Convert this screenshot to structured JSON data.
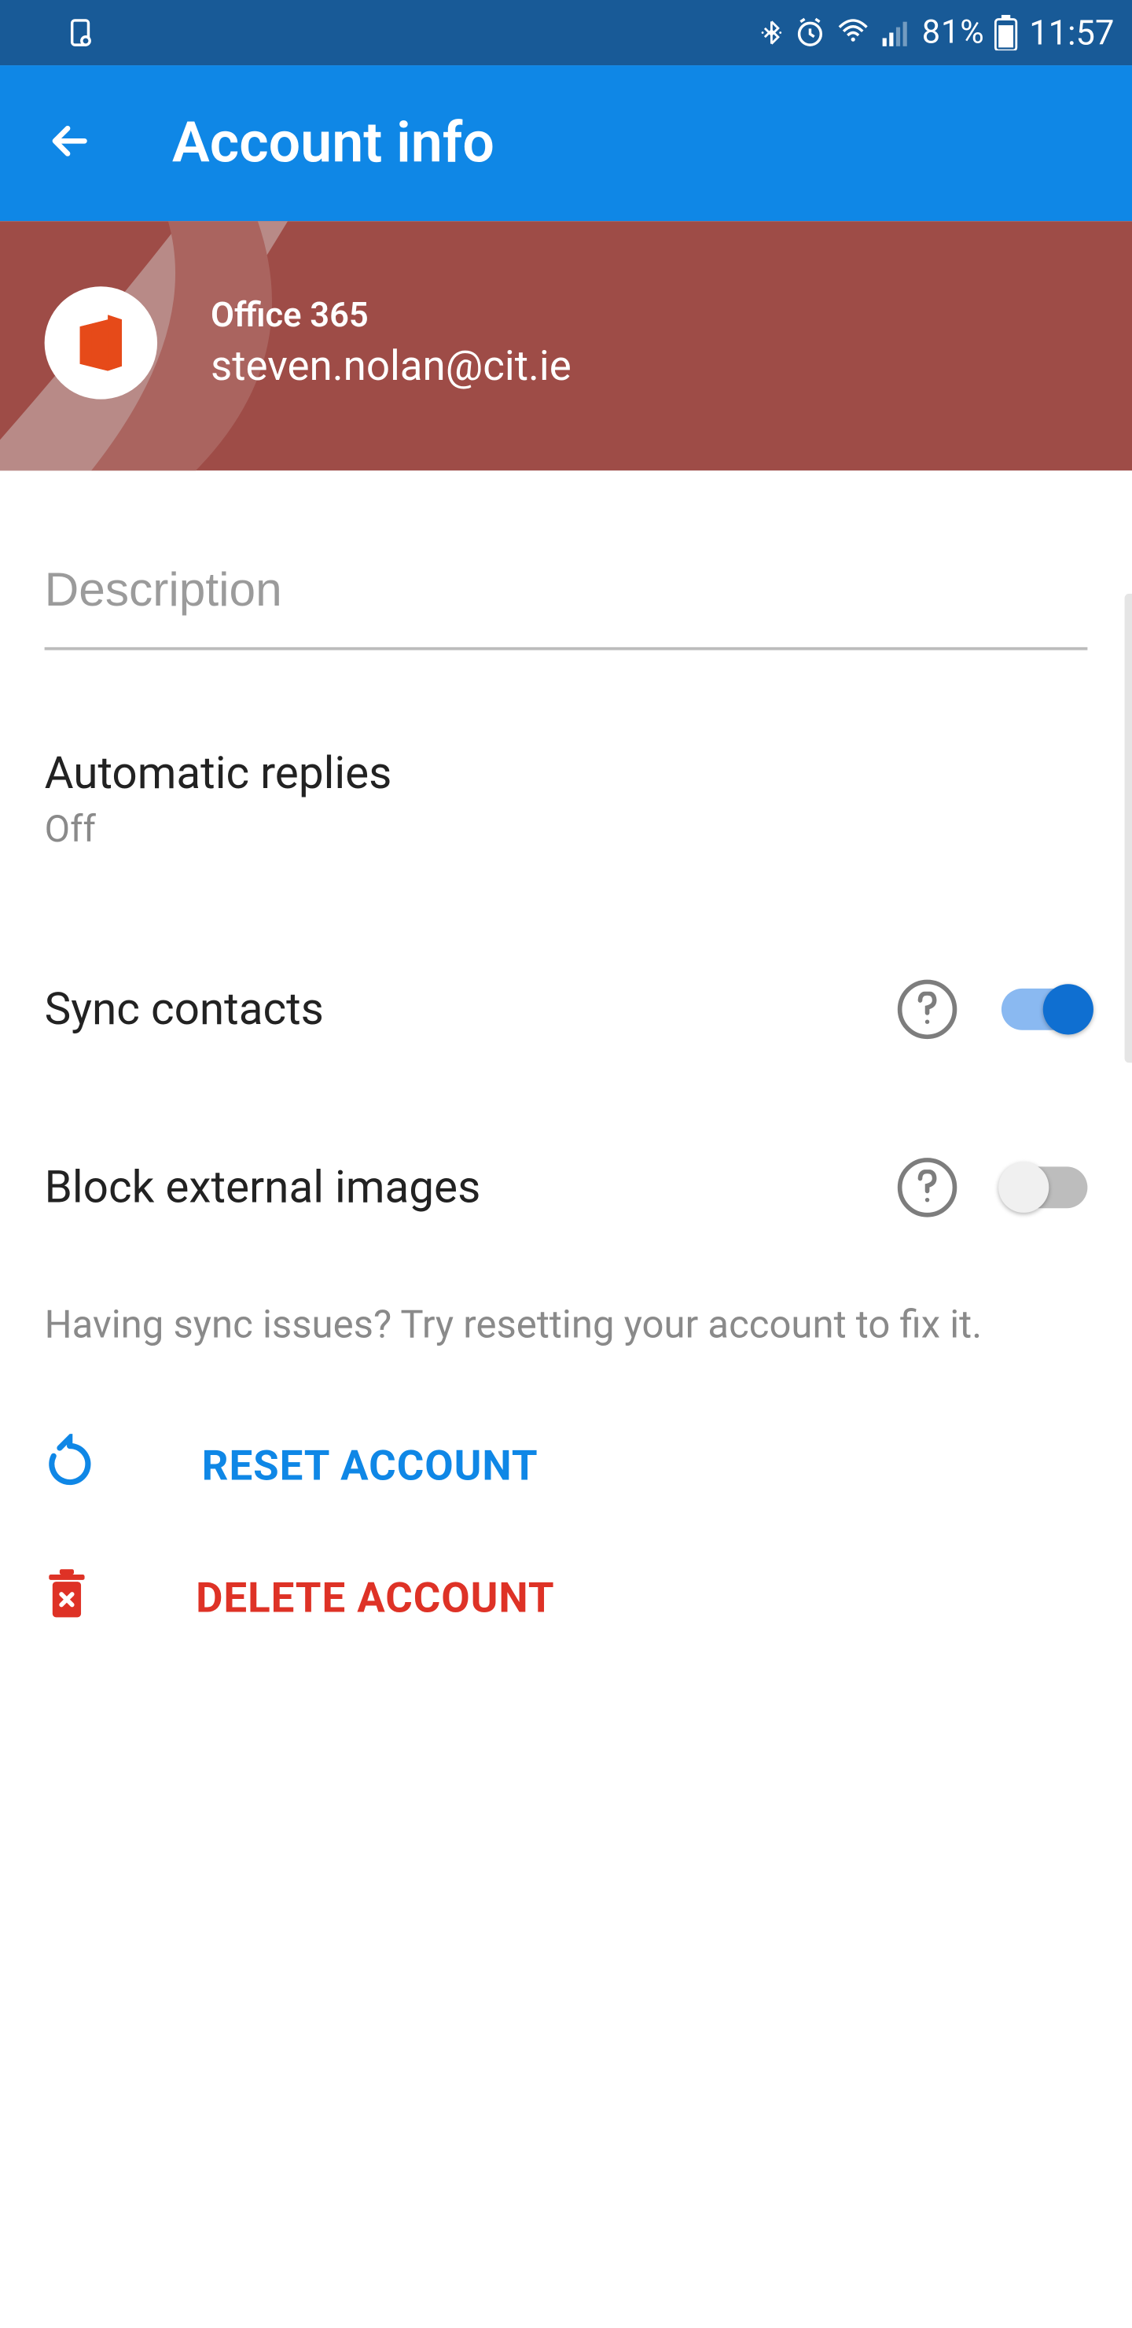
{
  "status": {
    "battery_pct": "81%",
    "time": "11:57"
  },
  "appbar": {
    "title": "Account info"
  },
  "account": {
    "provider": "Office 365",
    "email": "steven.nolan@cit.ie"
  },
  "description": {
    "placeholder": "Description",
    "value": ""
  },
  "rows": {
    "auto_replies": {
      "title": "Automatic replies",
      "status": "Off"
    },
    "sync_contacts": {
      "title": "Sync contacts",
      "toggle_on": true
    },
    "block_external": {
      "title": "Block external images",
      "toggle_on": false
    }
  },
  "sync_hint": "Having sync issues? Try resetting your account to fix it.",
  "actions": {
    "reset": "RESET ACCOUNT",
    "delete": "DELETE ACCOUNT"
  }
}
